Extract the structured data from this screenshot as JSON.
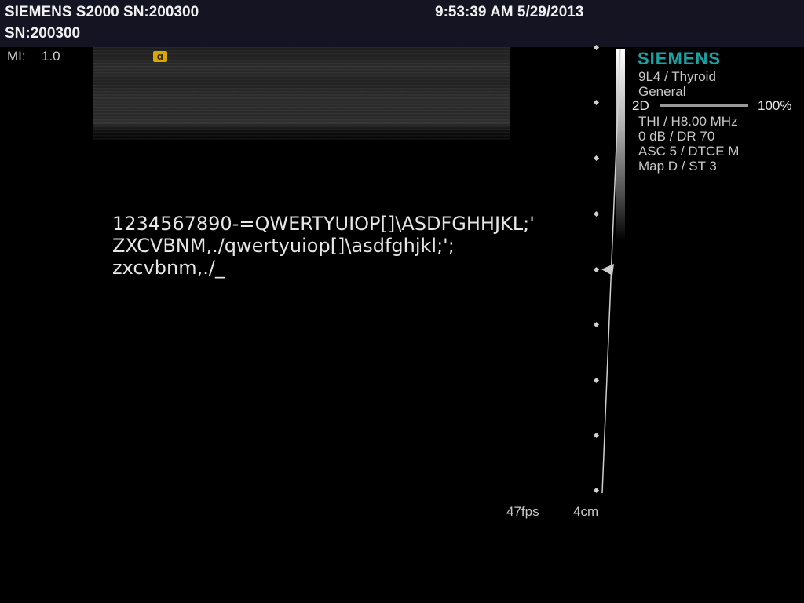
{
  "header": {
    "device_title": "SIEMENS S2000 SN:200300",
    "serial": "SN:200300",
    "datetime": "9:53:39 AM 5/29/2013"
  },
  "mi": {
    "label": "MI:",
    "value": "1.0"
  },
  "image_area": {
    "typed_text": "1234567890-=QWERTYUIOP[]\\ASDFGHHJKL;'\nZXCVBNM,./qwertyuiop[]\\asdfghjkl;';\nzxcvbnm,./_"
  },
  "side_panel": {
    "brand": "SIEMENS",
    "transducer": "9L4 / Thyroid",
    "preset": "General",
    "mode": "2D",
    "mode_percent": "100%",
    "mode_level": 1.0,
    "params": [
      "THI / H8.00 MHz",
      "0 dB / DR 70",
      "ASC 5 / DTCE M",
      "Map D / ST 3"
    ]
  },
  "footer": {
    "fps": "47fps",
    "depth": "4cm"
  },
  "colors": {
    "brand": "#1aa3a3",
    "header_bg": "#141422",
    "marker": "#d8a800"
  },
  "icons": {
    "orientation_marker": "orientation-marker-icon",
    "focus_marker": "focus-arrow-icon"
  }
}
